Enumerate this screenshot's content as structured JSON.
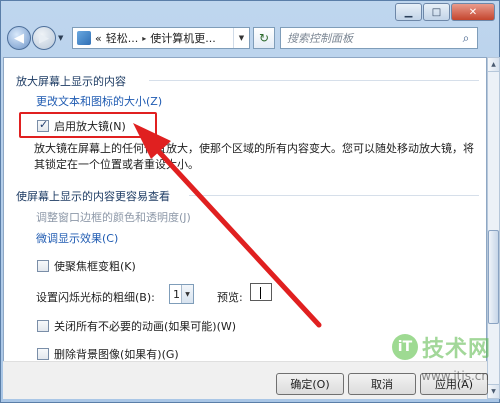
{
  "window": {
    "caption": {
      "minimize": "▁",
      "maximize": "□",
      "close": "✕"
    }
  },
  "navbar": {
    "back_glyph": "◀",
    "forward_glyph": "▶",
    "address_prefix": "«",
    "crumb1": "轻松...",
    "crumb_sep": "▸",
    "crumb2": "使计算机更...",
    "refresh_glyph": "↻",
    "search_placeholder": "搜索控制面板",
    "search_glyph": "⌕"
  },
  "content": {
    "section1_title": "放大屏幕上显示的内容",
    "link_text_size": "更改文本和图标的大小(Z)",
    "magnifier_label": "启用放大镜(N)",
    "magnifier_checked": true,
    "magnifier_desc": "放大镜在屏幕上的任何位置放大，使那个区域的所有内容变大。您可以随处移动放大镜，将其锁定在一个位置或者重设大小。",
    "section2_title": "使屏幕上显示的内容更容易查看",
    "link_window_colors": "调整窗口边框的颜色和透明度(J)",
    "link_display_effects": "微调显示效果(C)",
    "focus_thick_label": "使聚焦框变粗(K)",
    "cursor_width_label": "设置闪烁光标的粗细(B):",
    "cursor_width_value": "1",
    "preview_label": "预览:",
    "disable_animations_label": "关闭所有不必要的动画(如果可能)(W)",
    "remove_bg_label": "删除背景图像(如果有)(G)"
  },
  "buttons": {
    "ok": "确定(O)",
    "cancel": "取消",
    "apply": "应用(A)"
  },
  "watermark": {
    "logo": "iT",
    "text": "技术网",
    "url": "www.itjs.cn"
  },
  "colors": {
    "highlight_red": "#e02020",
    "link_blue": "#1f5bb2"
  }
}
